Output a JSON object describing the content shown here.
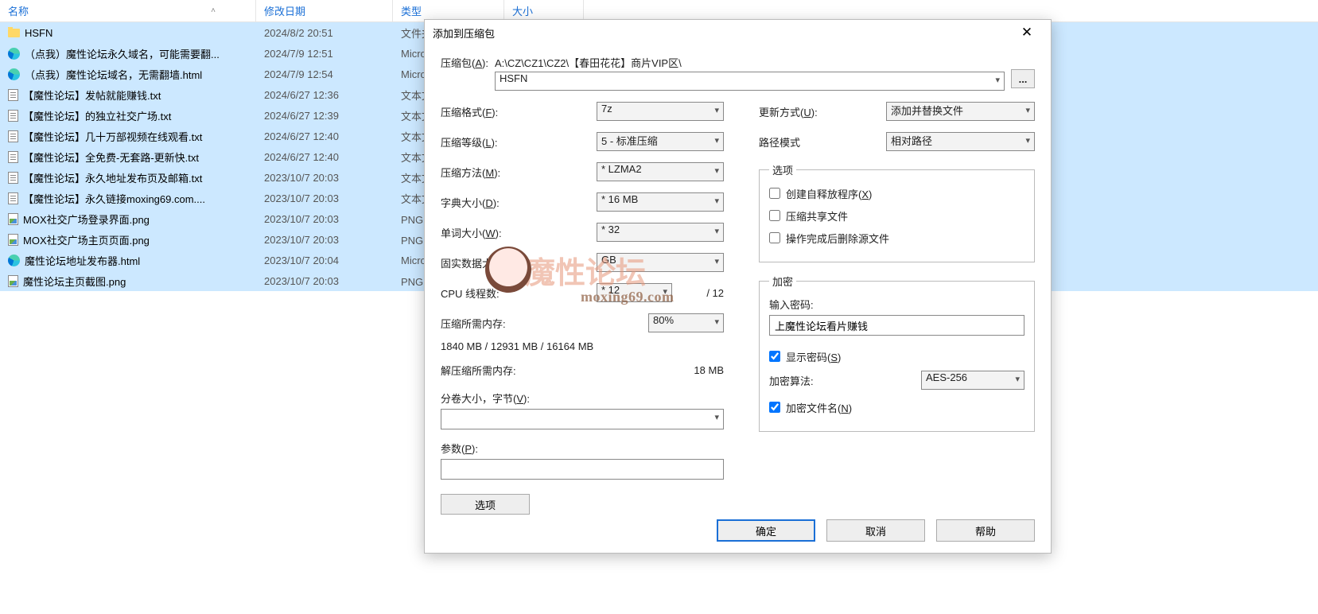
{
  "explorer": {
    "headers": {
      "name": "名称",
      "date": "修改日期",
      "type": "类型",
      "size": "大小"
    },
    "rows": [
      {
        "icon": "folder",
        "name": "HSFN",
        "date": "2024/8/2 20:51",
        "type": "文件夹",
        "sel": true
      },
      {
        "icon": "edge",
        "name": "（点我）魔性论坛永久域名，可能需要翻...",
        "date": "2024/7/9 12:51",
        "type": "Microsoft Edge HTML",
        "sel": true
      },
      {
        "icon": "edge",
        "name": "（点我）魔性论坛域名，无需翻墙.html",
        "date": "2024/7/9 12:54",
        "type": "Microsoft Edge HTML",
        "sel": true
      },
      {
        "icon": "txt",
        "name": "【魔性论坛】发帖就能赚钱.txt",
        "date": "2024/6/27 12:36",
        "type": "文本文档",
        "sel": true
      },
      {
        "icon": "txt",
        "name": "【魔性论坛】的独立社交广场.txt",
        "date": "2024/6/27 12:39",
        "type": "文本文档",
        "sel": true
      },
      {
        "icon": "txt",
        "name": "【魔性论坛】几十万部视频在线观看.txt",
        "date": "2024/6/27 12:40",
        "type": "文本文档",
        "sel": true
      },
      {
        "icon": "txt",
        "name": "【魔性论坛】全免费-无套路-更新快.txt",
        "date": "2024/6/27 12:40",
        "type": "文本文档",
        "sel": true
      },
      {
        "icon": "txt",
        "name": "【魔性论坛】永久地址发布页及邮箱.txt",
        "date": "2023/10/7 20:03",
        "type": "文本文档",
        "sel": true
      },
      {
        "icon": "txt",
        "name": "【魔性论坛】永久链接moxing69.com....",
        "date": "2023/10/7 20:03",
        "type": "文本文档",
        "sel": true
      },
      {
        "icon": "png",
        "name": "MOX社交广场登录界面.png",
        "date": "2023/10/7 20:03",
        "type": "PNG 图片",
        "sel": true
      },
      {
        "icon": "png",
        "name": "MOX社交广场主页页面.png",
        "date": "2023/10/7 20:03",
        "type": "PNG 图片",
        "sel": true
      },
      {
        "icon": "edge",
        "name": "魔性论坛地址发布器.html",
        "date": "2023/10/7 20:04",
        "type": "Microsoft Edge HTML",
        "sel": true
      },
      {
        "icon": "png",
        "name": "魔性论坛主页截图.png",
        "date": "2023/10/7 20:03",
        "type": "PNG 图片",
        "sel": true
      }
    ]
  },
  "dialog": {
    "title": "添加到压缩包",
    "archive_label": "压缩包(A):",
    "archive_path": "A:\\CZ\\CZ1\\CZ2\\【春田花花】商片VIP区\\",
    "archive_name": "HSFN",
    "browse": "...",
    "format_label": "压缩格式(F):",
    "format_value": "7z",
    "level_label": "压缩等级(L):",
    "level_value": "5 - 标准压缩",
    "method_label": "压缩方法(M):",
    "method_value": "* LZMA2",
    "dict_label": "字典大小(D):",
    "dict_value": "* 16 MB",
    "word_label": "单词大小(W):",
    "word_value": "* 32",
    "solid_label": "固实数据大小:",
    "solid_value": "GB",
    "threads_label": "CPU 线程数:",
    "threads_value": "* 12",
    "threads_max": "/ 12",
    "mem_compress_label": "压缩所需内存:",
    "mem_compress_value": "1840 MB / 12931 MB / 16164 MB",
    "mem_compress_pct": "80%",
    "mem_decompress_label": "解压缩所需内存:",
    "mem_decompress_value": "18 MB",
    "volume_label": "分卷大小，字节(V):",
    "params_label": "参数(P):",
    "options_btn": "选项",
    "update_label": "更新方式(U):",
    "update_value": "添加并替换文件",
    "pathmode_label": "路径模式",
    "pathmode_value": "相对路径",
    "options_group": "选项",
    "opt_sfx": "创建自释放程序(X)",
    "opt_share": "压缩共享文件",
    "opt_delete": "操作完成后删除源文件",
    "enc_group": "加密",
    "pwd_label": "输入密码:",
    "pwd_value": "上魔性论坛看片赚钱",
    "show_pwd": "显示密码(S)",
    "enc_method_label": "加密算法:",
    "enc_method_value": "AES-256",
    "enc_names": "加密文件名(N)",
    "ok": "确定",
    "cancel": "取消",
    "help": "帮助"
  },
  "watermark": {
    "text": "魔性论坛",
    "sub": "moxing69.com"
  }
}
